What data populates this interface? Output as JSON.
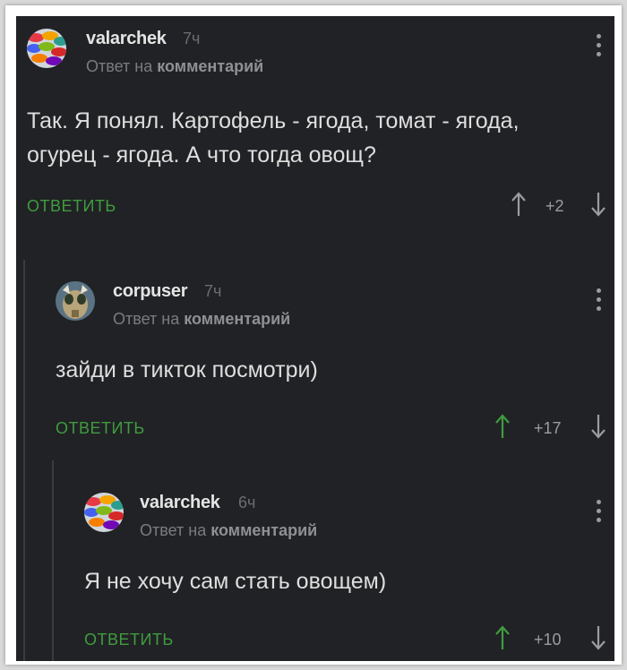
{
  "comments": [
    {
      "username": "valarchek",
      "time": "7ч",
      "reply_prefix": "Ответ на",
      "reply_link": "комментарий",
      "text": "Так. Я понял. Картофель - ягода, томат - ягода, огурец - ягода. А что тогда овощ?",
      "reply_label": "ОТВЕТИТЬ",
      "score": "+2",
      "upvoted": false
    },
    {
      "username": "corpuser",
      "time": "7ч",
      "reply_prefix": "Ответ на",
      "reply_link": "комментарий",
      "text": "зайди в тикток посмотри)",
      "reply_label": "ОТВЕТИТЬ",
      "score": "+17",
      "upvoted": true
    },
    {
      "username": "valarchek",
      "time": "6ч",
      "reply_prefix": "Ответ на",
      "reply_link": "комментарий",
      "text": "Я не хочу сам стать овощем)",
      "reply_label": "ОТВЕТИТЬ",
      "score": "+10",
      "upvoted": true
    }
  ],
  "colors": {
    "background": "#212225",
    "accent_green": "#3f9c3f",
    "text": "#dedede"
  },
  "icons": [
    "more-vertical-icon",
    "arrow-up-icon",
    "arrow-down-icon",
    "user-avatar-umbrellas",
    "user-avatar-creature"
  ]
}
